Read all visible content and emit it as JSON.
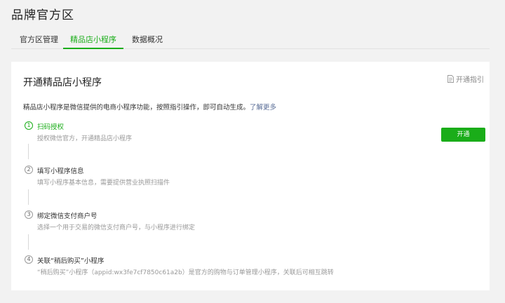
{
  "page": {
    "title": "品牌官方区"
  },
  "tabs": [
    {
      "label": "官方区管理"
    },
    {
      "label": "精品店小程序"
    },
    {
      "label": "数据概况"
    }
  ],
  "card": {
    "title": "开通精品店小程序",
    "guide_label": "开通指引",
    "description": "精品店小程序是微信提供的电商小程序功能，按照指引操作，即可自动生成。",
    "learn_more": "了解更多",
    "open_button": "开通"
  },
  "steps": [
    {
      "num": "1",
      "title": "扫码授权",
      "subtitle": "授权微信官方，开通精品店小程序",
      "active": true
    },
    {
      "num": "2",
      "title": "填写小程序信息",
      "subtitle": "填写小程序基本信息，需要提供营业执照扫描件",
      "active": false
    },
    {
      "num": "3",
      "title": "绑定微信支付商户号",
      "subtitle": "选择一个用于交易的微信支付商户号，与小程序进行绑定",
      "active": false
    },
    {
      "num": "4",
      "title": "关联“稍后购买”小程序",
      "subtitle": "“稍后购买”小程序（appid:wx3fe7cf7850c61a2b）是官方的购物与订单管理小程序，关联后可相互跳转",
      "active": false
    }
  ],
  "colors": {
    "accent": "#1aad19",
    "link": "#576b95",
    "background": "#f2f2f2"
  }
}
